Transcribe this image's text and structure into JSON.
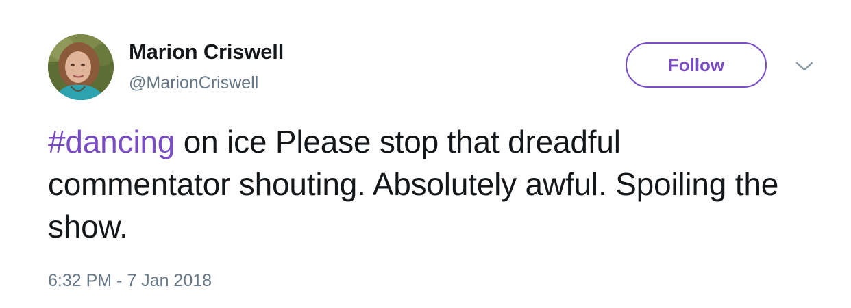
{
  "tweet": {
    "author": {
      "display_name": "Marion Criswell",
      "handle": "@MarionCriswell"
    },
    "follow_label": "Follow",
    "menu_icon": "chevron-down-icon",
    "text": {
      "hashtag": "#dancing",
      "body": " on ice Please stop that dreadful commentator shouting. Absolutely awful. Spoiling the show."
    },
    "timestamp": "6:32 PM - 7 Jan 2018"
  },
  "colors": {
    "accent": "#794bc4",
    "text": "#14171a",
    "secondary_text": "#657786"
  }
}
